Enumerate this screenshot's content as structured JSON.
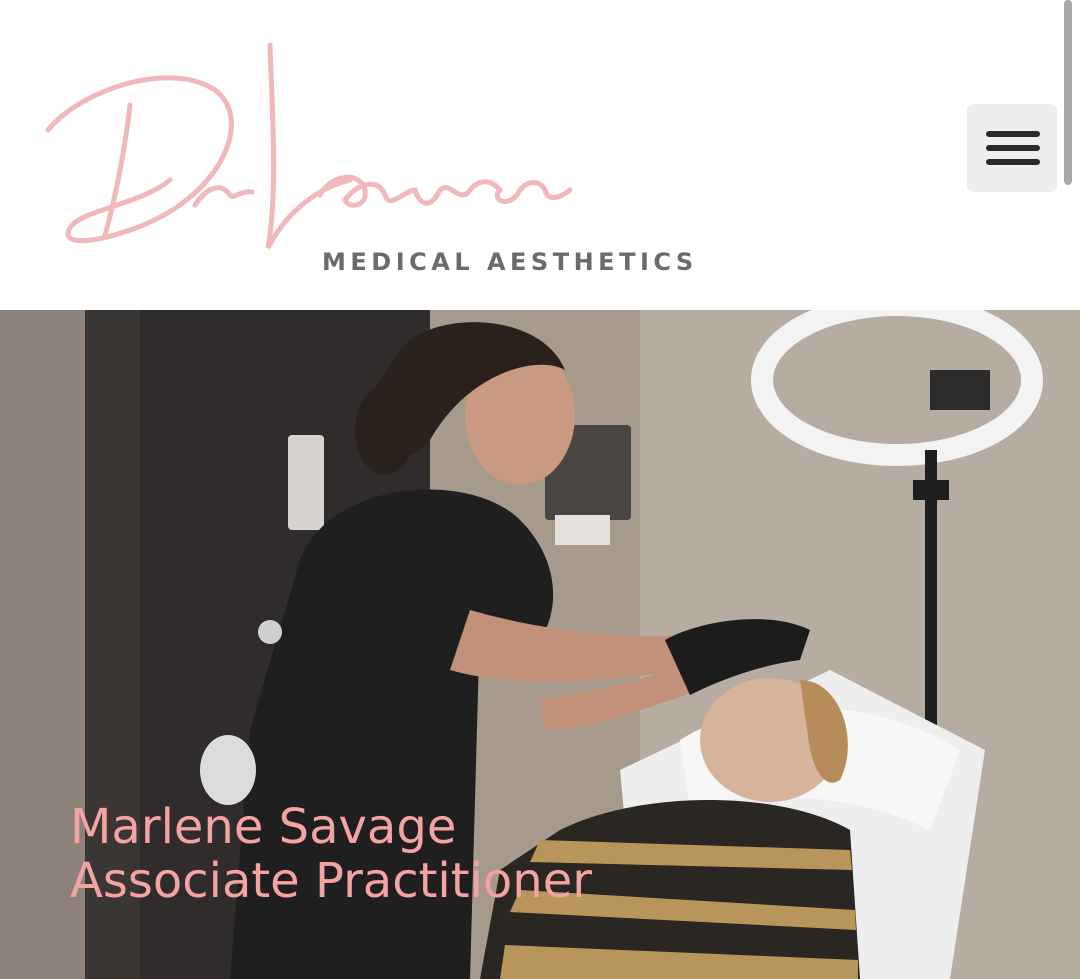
{
  "header": {
    "logo_script": "Dr Lauren",
    "logo_tagline": "MEDICAL AESTHETICS",
    "menu_icon": "hamburger-menu-icon"
  },
  "hero": {
    "name": "Marlene Savage",
    "role": "Associate Practitioner"
  },
  "colors": {
    "brand_pink": "#f0b8ba",
    "caption_pink": "#f4a3a3",
    "tagline_gray": "#6b6b6b"
  }
}
